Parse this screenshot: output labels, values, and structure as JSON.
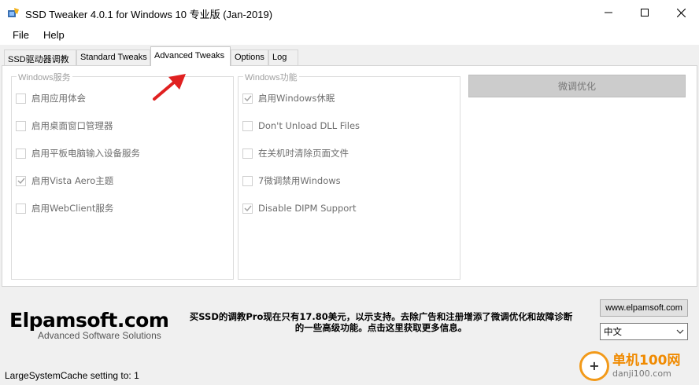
{
  "window": {
    "title": "SSD Tweaker 4.0.1 for Windows 10 专业版 (Jan-2019)"
  },
  "menu": [
    {
      "label": "File"
    },
    {
      "label": "Help"
    }
  ],
  "tabs": [
    {
      "label": "SSD驱动器调教",
      "active": false
    },
    {
      "label": "Standard Tweaks",
      "active": false
    },
    {
      "label": "Advanced Tweaks",
      "active": true
    },
    {
      "label": "Options",
      "active": false
    },
    {
      "label": "Log",
      "active": false
    }
  ],
  "groups": {
    "services": {
      "title": "Windows服务",
      "items": [
        {
          "label": "启用应用体会",
          "checked": false
        },
        {
          "label": "启用桌面窗口管理器",
          "checked": false
        },
        {
          "label": "启用平板电脑输入设备服务",
          "checked": false
        },
        {
          "label": "启用Vista Aero主题",
          "checked": true
        },
        {
          "label": "启用WebClient服务",
          "checked": false
        }
      ]
    },
    "features": {
      "title": "Windows功能",
      "items": [
        {
          "label": "启用Windows休眠",
          "checked": true
        },
        {
          "label": "Don't Unload DLL Files",
          "checked": false
        },
        {
          "label": "在关机时清除页面文件",
          "checked": false
        },
        {
          "label": "7微调禁用Windows",
          "checked": false
        },
        {
          "label": "Disable DIPM Support",
          "checked": true
        }
      ]
    }
  },
  "tune_button": {
    "label": "微调优化"
  },
  "bottom": {
    "logo_main": "Elpamsoft.com",
    "logo_sub": "Advanced Software Solutions",
    "promo_line1": "买SSD的调教Pro现在只有17.80美元，以示支持。去除广告和注册增添了微调优化和故障诊断",
    "promo_line2": "的一些高级功能。点击这里获取更多信息。",
    "site_button": "www.elpamsoft.com",
    "language": "中文",
    "status": "LargeSystemCache setting to: 1"
  },
  "watermark": {
    "brand": "单机100网",
    "url": "danji100.com"
  },
  "colors": {
    "accent_arrow": "#e02020",
    "watermark_orange": "#f08a00"
  }
}
